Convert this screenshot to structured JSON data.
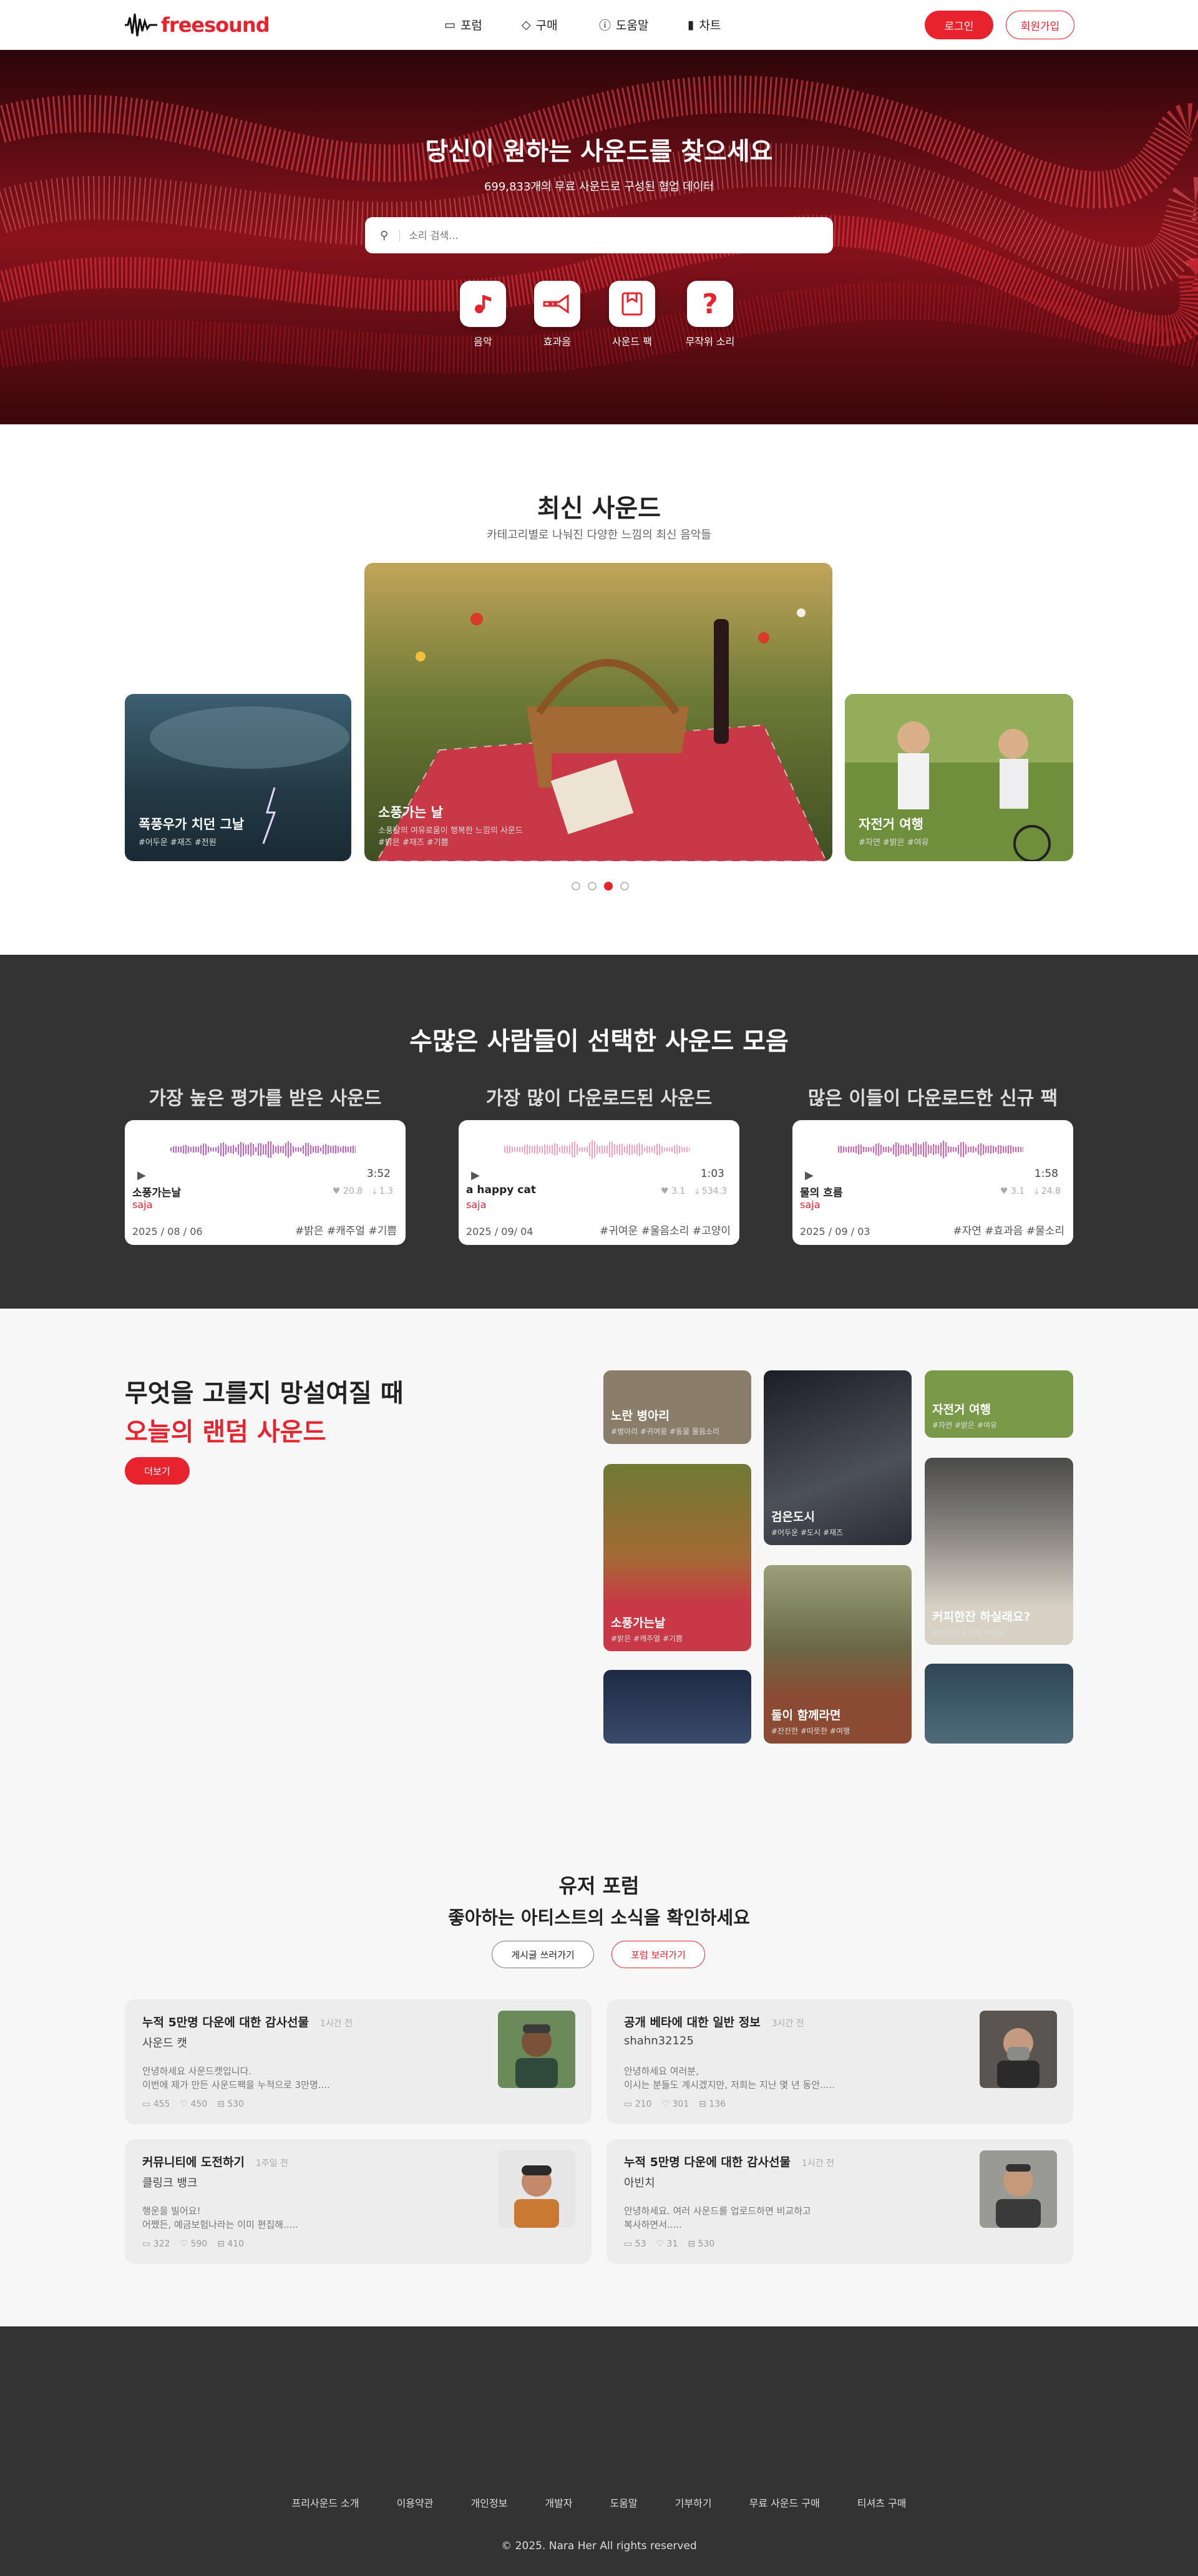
{
  "header": {
    "logo": "freesound",
    "nav": [
      {
        "label": "포럼",
        "icon": "forum-icon"
      },
      {
        "label": "구매",
        "icon": "tag-icon"
      },
      {
        "label": "도움말",
        "icon": "help-icon"
      },
      {
        "label": "차트",
        "icon": "chart-icon"
      }
    ],
    "login": "로그인",
    "signup": "회원가입"
  },
  "hero": {
    "title": "당신이 원하는 사운드를 찾으세요",
    "subtitle": "699,833개의 무료 사운드로 구성된 협업 데이터",
    "search_placeholder": "소리 검색...",
    "categories": [
      {
        "label": "음악",
        "icon": "music-note-icon"
      },
      {
        "label": "효과음",
        "icon": "trumpet-icon"
      },
      {
        "label": "사운드 팩",
        "icon": "sound-pack-icon"
      },
      {
        "label": "무작위 소리",
        "icon": "question-icon"
      }
    ]
  },
  "latest": {
    "title": "최신 사운드",
    "subtitle": "카테고리별로 나눠진 다양한 느낌의 최신 음악들",
    "cards": [
      {
        "title": "폭풍우가 치던 그날",
        "tags": "#어두운 #재즈 #전원"
      },
      {
        "title": "소풍가는 날",
        "desc": "소풍날의 여유로움이 행복한 느낌의 사운드",
        "tags": "#밝은 #재즈 #기쁨"
      },
      {
        "title": "자전거 여행",
        "tags": "#자연 #밝은 #여유"
      }
    ],
    "active_dot": 3,
    "dot_count": 4
  },
  "popular": {
    "title": "수많은 사람들이 선택한 사운드 모음",
    "columns": [
      {
        "heading": "가장 높은 평가를 받은 사운드",
        "track": "소풍가는날",
        "author": "saja",
        "time": "3:52",
        "likes": "20.8",
        "downloads": "1.3",
        "date": "2025 / 08 / 06",
        "tags": "#밝은 #캐주얼 #기쁨"
      },
      {
        "heading": "가장 많이 다운로드된 사운드",
        "track": "a happy cat",
        "author": "saja",
        "time": "1:03",
        "likes": "3.1",
        "downloads": "534.3",
        "date": "2025 / 09/ 04",
        "tags": "#귀여운 #울음소리 #고양이"
      },
      {
        "heading": "많은 이들이 다운로드한 신규 팩",
        "track": "물의 흐름",
        "author": "saja",
        "time": "1:58",
        "likes": "3.1",
        "downloads": "24.8",
        "date": "2025 / 09 / 03",
        "tags": "#자연 #효과음 #물소리"
      }
    ]
  },
  "random": {
    "line1": "무엇을 고를지 망설여질 때",
    "line2": "오늘의 랜덤 사운드",
    "more": "더보기",
    "tiles": [
      {
        "title": "노란 병아리",
        "tags": "#병아리 #귀여움 #동물 울음소리"
      },
      {
        "title": "검은도시",
        "tags": "#어두운 #도시 #재즈"
      },
      {
        "title": "자전거 여행",
        "tags": "#자연 #밝은 #여유"
      },
      {
        "title": "소풍가는날",
        "tags": "#밝은 #캐주얼 #기쁨"
      },
      {
        "title": "둘이 함께라면",
        "tags": "#잔잔한 #따뜻한 #여행"
      },
      {
        "title": "커피한잔 하실래요?",
        "tags": "#잔잔한 #카페 #여유"
      },
      {
        "title": "",
        "tags": ""
      },
      {
        "title": "",
        "tags": ""
      }
    ]
  },
  "forum": {
    "title": "유저 포럼",
    "subtitle": "좋아하는 아티스트의 소식을 확인하세요",
    "write": "게시글 쓰러가기",
    "view": "포럼 보러가기",
    "posts": [
      {
        "title": "누적 5만명 다운에 대한 감사선물",
        "when": "1시간 전",
        "author": "사운드 캣",
        "body1": "안녕하세요 사운드캣입니다.",
        "body2": "이번에 제가 만든 사운드팩을 누적으로 3만명....",
        "comments": "455",
        "likes": "450",
        "views": "530"
      },
      {
        "title": "공개 베타에 대한 일반 정보",
        "when": "3시간 전",
        "author": "shahn32125",
        "body1": "안녕하세요 여러분,",
        "body2": "이시는 분들도 계시겠지만, 저희는 지난 몇 년 동안.....",
        "comments": "210",
        "likes": "301",
        "views": "136"
      },
      {
        "title": "커뮤니티에 도전하기",
        "when": "1주일 전",
        "author": "클링크 뱅크",
        "body1": "행운을 빌어요!",
        "body2": "어쨌든, 예금보험나라는 이미 편집해.....",
        "comments": "322",
        "likes": "590",
        "views": "410"
      },
      {
        "title": "누적 5만명 다운에 대한 감사선물",
        "when": "1시간 전",
        "author": "아빈치",
        "body1": "안녕하세요. 여러 사운드를 업로드하면 비교하고",
        "body2": "복사하면서.....",
        "comments": "53",
        "likes": "31",
        "views": "530"
      }
    ]
  },
  "footer": {
    "links": [
      "프리사운드 소개",
      "이용약관",
      "개인정보",
      "개발자",
      "도움말",
      "기부하기",
      "무료 사운드 구매",
      "티셔츠 구매"
    ],
    "copyright": "© 2025. Nara Her All rights reserved"
  },
  "colors": {
    "accent": "#e8232e",
    "dark": "#333333"
  }
}
